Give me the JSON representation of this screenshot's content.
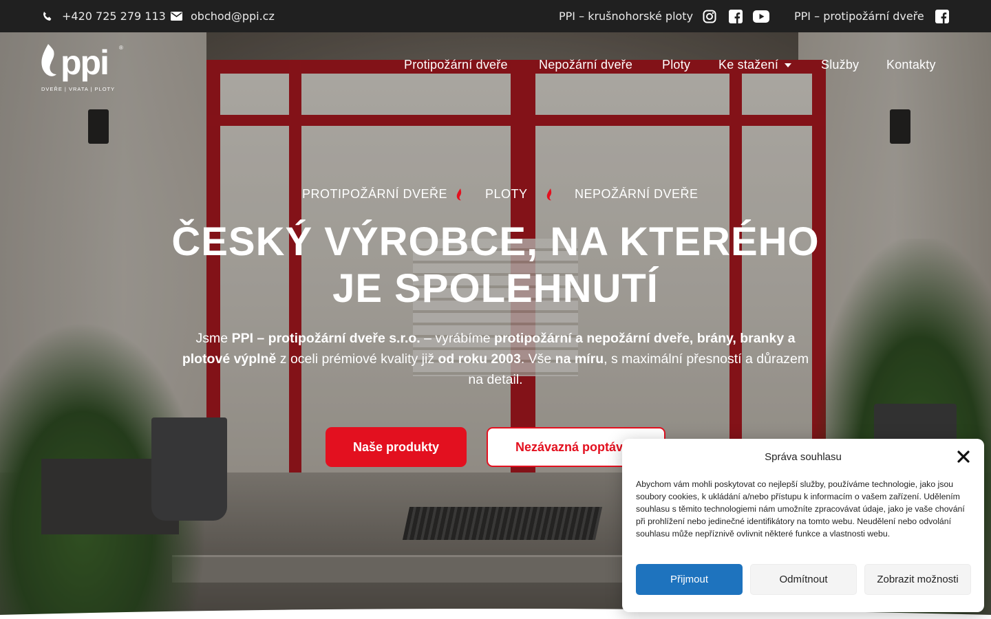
{
  "topbar": {
    "phone": "+420 725 279 113",
    "email": "obchod@ppi.cz",
    "link1": "PPI – krušnohorské ploty",
    "link2": "PPI – protipožární dveře"
  },
  "logo": {
    "name": "ppi",
    "tagline": "DVEŘE | VRATA | PLOTY"
  },
  "nav": {
    "items": [
      {
        "label": "Protipožární dveře"
      },
      {
        "label": "Nepožární dveře"
      },
      {
        "label": "Ploty"
      },
      {
        "label": "Ke stažení"
      },
      {
        "label": "Služby"
      },
      {
        "label": "Kontakty"
      }
    ]
  },
  "hero": {
    "categories": [
      "PROTIPOŽÁRNÍ DVEŘE",
      "PLOTY",
      "NEPOŽÁRNÍ DVEŘE"
    ],
    "headline_line1": "ČESKÝ VÝROBCE, NA KTERÉHO",
    "headline_line2": "JE SPOLEHNUTÍ",
    "intro": {
      "p1": "Jsme ",
      "b1": "PPI – protipožární dveře s.r.o.",
      "p2": " – vyrábíme ",
      "b2": "protipožární a nepožární dveře, brány, branky a plotové výplně",
      "p3": " z oceli prémiové kvality již ",
      "b3": "od roku 2003",
      "p4": ". Vše ",
      "b4": "na míru",
      "p5": ", s maximální přesností a důrazem na detail."
    },
    "btn_primary": "Naše produkty",
    "btn_secondary": "Nezávazná poptávka"
  },
  "cookie": {
    "title": "Správa souhlasu",
    "text": "Abychom vám mohli poskytovat co nejlepší služby, používáme technologie, jako jsou soubory cookies, k ukládání a/nebo přístupu k informacím o vašem zařízení. Udělením souhlasu s těmito technologiemi nám umožníte zpracovávat údaje, jako je vaše chování při prohlížení nebo jedinečné identifikátory na tomto webu. Neudělení nebo odvolání souhlasu může nepříznivě ovlivnit některé funkce a vlastnosti webu.",
    "accept": "Přijmout",
    "deny": "Odmítnout",
    "prefs": "Zobrazit možnosti"
  },
  "colors": {
    "accent": "#e3101f",
    "topbar": "#202020",
    "cookie_accept": "#1e73be"
  }
}
